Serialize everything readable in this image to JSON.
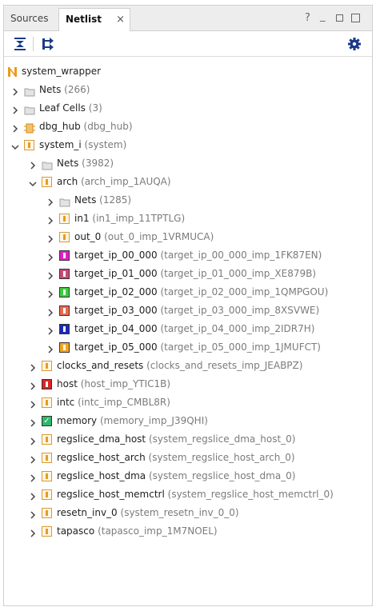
{
  "tabs": [
    {
      "label": "Sources"
    },
    {
      "label": "Netlist",
      "active": true,
      "close": "×"
    }
  ],
  "window_controls": {
    "help": "?",
    "minimize": "_"
  },
  "toolbar": {
    "collapse_icon": "collapse-all-icon",
    "expand_icon": "expand-all-icon",
    "settings_icon": "gear-icon"
  },
  "colors": {
    "accent_orange": "#e89b1f",
    "target_00": "#e01fc8",
    "target_01": "#c74a7a",
    "target_02": "#3fc93f",
    "target_03": "#ea6a4c",
    "target_04": "#1c2ab8",
    "target_05": "#f2a623",
    "host": "#d92525",
    "memory_check": "#2fb86a"
  },
  "tree": [
    {
      "name": "system_wrapper",
      "detail": "",
      "icon": "design-n-icon"
    },
    {
      "name": "Nets",
      "detail": "(266)",
      "icon": "folder-icon"
    },
    {
      "name": "Leaf Cells",
      "detail": "(3)",
      "icon": "folder-icon"
    },
    {
      "name": "dbg_hub",
      "detail": "(dbg_hub)",
      "icon": "debug-hub-icon"
    },
    {
      "name": "system_i",
      "detail": "(system)",
      "icon": "cell-icon"
    },
    {
      "name": "Nets",
      "detail": "(3982)",
      "icon": "folder-icon"
    },
    {
      "name": "arch",
      "detail": "(arch_imp_1AUQA)",
      "icon": "cell-icon"
    },
    {
      "name": "Nets",
      "detail": "(1285)",
      "icon": "folder-icon"
    },
    {
      "name": "in1",
      "detail": "(in1_imp_11TPTLG)",
      "icon": "cell-icon"
    },
    {
      "name": "out_0",
      "detail": "(out_0_imp_1VRMUCA)",
      "icon": "cell-icon"
    },
    {
      "name": "target_ip_00_000",
      "detail": "(target_ip_00_000_imp_1FK87EN)",
      "icon": "colored-cell-icon"
    },
    {
      "name": "target_ip_01_000",
      "detail": "(target_ip_01_000_imp_XE879B)",
      "icon": "colored-cell-icon"
    },
    {
      "name": "target_ip_02_000",
      "detail": "(target_ip_02_000_imp_1QMPGOU)",
      "icon": "colored-cell-icon"
    },
    {
      "name": "target_ip_03_000",
      "detail": "(target_ip_03_000_imp_8XSVWE)",
      "icon": "colored-cell-icon"
    },
    {
      "name": "target_ip_04_000",
      "detail": "(target_ip_04_000_imp_2IDR7H)",
      "icon": "colored-cell-icon"
    },
    {
      "name": "target_ip_05_000",
      "detail": "(target_ip_05_000_imp_1JMUFCT)",
      "icon": "colored-cell-icon"
    },
    {
      "name": "clocks_and_resets",
      "detail": "(clocks_and_resets_imp_JEABPZ)",
      "icon": "cell-icon"
    },
    {
      "name": "host",
      "detail": "(host_imp_YTIC1B)",
      "icon": "colored-cell-icon"
    },
    {
      "name": "intc",
      "detail": "(intc_imp_CMBL8R)",
      "icon": "cell-icon"
    },
    {
      "name": "memory",
      "detail": "(memory_imp_J39QHI)",
      "icon": "checked-cell-icon"
    },
    {
      "name": "regslice_dma_host",
      "detail": "(system_regslice_dma_host_0)",
      "icon": "cell-icon"
    },
    {
      "name": "regslice_host_arch",
      "detail": "(system_regslice_host_arch_0)",
      "icon": "cell-icon"
    },
    {
      "name": "regslice_host_dma",
      "detail": "(system_regslice_host_dma_0)",
      "icon": "cell-icon"
    },
    {
      "name": "regslice_host_memctrl",
      "detail": "(system_regslice_host_memctrl_0)",
      "icon": "cell-icon"
    },
    {
      "name": "resetn_inv_0",
      "detail": "(system_resetn_inv_0_0)",
      "icon": "cell-icon"
    },
    {
      "name": "tapasco",
      "detail": "(tapasco_imp_1M7NOEL)",
      "icon": "cell-icon"
    }
  ]
}
